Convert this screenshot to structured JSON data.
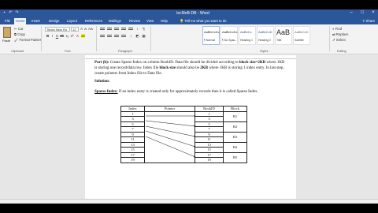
{
  "window": {
    "title": "lec9InB-DB - Word"
  },
  "quick_access": [
    "save-icon",
    "undo-icon",
    "redo-icon"
  ],
  "tabs": [
    "File",
    "Home",
    "Insert",
    "Design",
    "Layout",
    "References",
    "Mailings",
    "Review",
    "View",
    "Help"
  ],
  "tell_me": "Tell me what you want to do",
  "share_label": "Share",
  "ribbon": {
    "paste": "Paste",
    "clipboard_items": [
      "Cut",
      "Copy",
      "Format Painter"
    ],
    "font_name": "Times New Ro",
    "font_size": "12",
    "styles": [
      {
        "sample": "AaBbCcDc",
        "name": "¶ Normal"
      },
      {
        "sample": "AaBbCcDc",
        "name": "¶ No Spac..."
      },
      {
        "sample": "AaBbCc",
        "name": "Heading 1"
      },
      {
        "sample": "AaBbCcD",
        "name": "Heading 2"
      },
      {
        "sample": "AaB",
        "name": "Title"
      },
      {
        "sample": "AaBbCcD",
        "name": "Subtitle"
      }
    ],
    "editing_items": [
      "Find",
      "Replace",
      "Select"
    ],
    "group_labels": [
      "Clipboard",
      "Font",
      "Paragraph",
      "Styles",
      "Editing"
    ]
  },
  "document": {
    "part_label": "Part (b):",
    "part_text": " Create Sparse Index on column BookID. Data file should be divided according to ",
    "part_bold1": "block size=2KB",
    "part_text2": " where 1KB is storing one record/data row. Index file ",
    "part_bold2": "block size",
    "part_text3": " should also be ",
    "part_bold3": "2KB",
    "part_text4": " where 1KB is storing 1 index entry. In last step, create pointers from Index file to Data file.",
    "solution": "Solution:",
    "sparse_label": "Sparse Index:",
    "sparse_text": " If an index entry is created only for approximately records then it is called Sparse Index."
  },
  "table": {
    "headers": [
      "Index",
      "Pointer",
      "BookID",
      "Block"
    ],
    "index_values": [
      "1",
      "3",
      "5",
      "7",
      "9",
      "11",
      "13",
      "15",
      "17",
      "19"
    ],
    "book_ids": [
      "1",
      "3",
      "5",
      "7",
      "9",
      "11",
      "13",
      "15",
      "17",
      "19"
    ],
    "blocks": [
      "B1",
      "B2",
      "B3",
      "B4",
      "B5"
    ]
  }
}
